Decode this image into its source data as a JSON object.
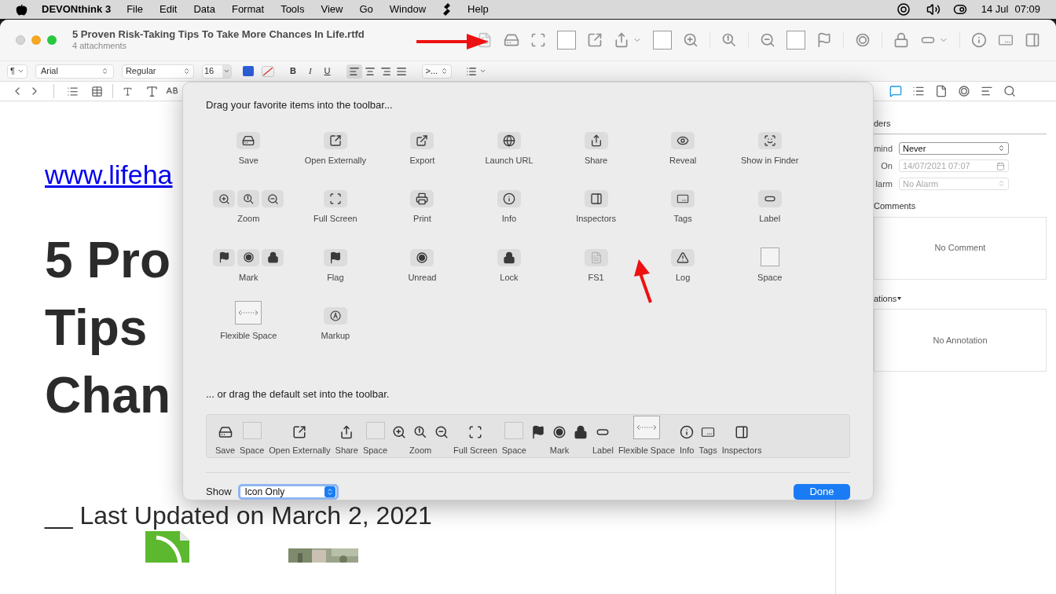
{
  "menubar": {
    "app": "DEVONthink 3",
    "menus": [
      "File",
      "Edit",
      "Data",
      "Format",
      "Tools",
      "View",
      "Go",
      "Window"
    ],
    "help": "Help",
    "date": "14 Jul",
    "time": "07:09"
  },
  "window": {
    "title": "5 Proven Risk-Taking Tips To Take More Chances In Life.rtfd",
    "subtitle": "4 attachments"
  },
  "toolbar": [
    {
      "kind": "fs1"
    },
    {
      "kind": "save"
    },
    {
      "kind": "fullscreen"
    },
    {
      "kind": "space"
    },
    {
      "kind": "openexternally"
    },
    {
      "kind": "share"
    },
    {
      "kind": "space"
    },
    {
      "kind": "zoomin"
    },
    {
      "kind": "actualsize"
    },
    {
      "kind": "zoomout"
    },
    {
      "kind": "space"
    },
    {
      "kind": "flag"
    },
    {
      "kind": "unread"
    },
    {
      "kind": "lock"
    },
    {
      "kind": "label"
    },
    {
      "kind": "info"
    },
    {
      "kind": "tags"
    },
    {
      "kind": "inspectors"
    }
  ],
  "format_bar": {
    "paragraph": "¶",
    "font": "Arial",
    "style": "Regular",
    "size": "16",
    "bold": "B",
    "italic": "I",
    "underline": "U",
    "alignment": [
      {
        "kind": "left",
        "selected": true
      },
      {
        "kind": "center",
        "selected": false
      },
      {
        "kind": "right",
        "selected": false
      },
      {
        "kind": "justify",
        "selected": false
      }
    ],
    "spacing": ">..."
  },
  "inspector_tabs": [
    {
      "kind": "comment",
      "selected": true
    },
    {
      "kind": "list",
      "selected": false
    },
    {
      "kind": "document",
      "selected": false
    },
    {
      "kind": "circle",
      "selected": false
    },
    {
      "kind": "lines",
      "selected": false
    },
    {
      "kind": "search",
      "selected": false
    }
  ],
  "document": {
    "link": "www.lifeha",
    "heading": [
      "5 Pro",
      "Tips",
      "Chan"
    ],
    "updated": "__ Last Updated on March 2, 2021"
  },
  "inspector": {
    "reminders": "ders",
    "fields": [
      {
        "label": "mind",
        "value": "Never",
        "disabled": false,
        "kind": "popup"
      },
      {
        "label": "On",
        "value": "14/07/2021 07:07",
        "disabled": true,
        "kind": "date"
      },
      {
        "label": "larm",
        "value": "No Alarm",
        "disabled": true,
        "kind": "popup"
      }
    ],
    "comments": {
      "heading": "Comments",
      "text": "No Comment"
    },
    "annotations": {
      "heading": "ations",
      "text": "No Annotation"
    }
  },
  "sheet": {
    "intro": "Drag your favorite items into the toolbar...",
    "items": [
      {
        "kind": "save",
        "label": "Save"
      },
      {
        "kind": "openexternally",
        "label": "Open Externally"
      },
      {
        "kind": "export",
        "label": "Export"
      },
      {
        "kind": "launchurl",
        "label": "Launch URL"
      },
      {
        "kind": "share",
        "label": "Share"
      },
      {
        "kind": "reveal",
        "label": "Reveal"
      },
      {
        "kind": "finder",
        "label": "Show in Finder"
      },
      {
        "kind": "zoom",
        "label": "Zoom"
      },
      {
        "kind": "fullscreen",
        "label": "Full Screen"
      },
      {
        "kind": "print",
        "label": "Print"
      },
      {
        "kind": "info",
        "label": "Info"
      },
      {
        "kind": "inspectors",
        "label": "Inspectors"
      },
      {
        "kind": "tags",
        "label": "Tags"
      },
      {
        "kind": "label",
        "label": "Label"
      },
      {
        "kind": "mark",
        "label": "Mark"
      },
      {
        "kind": "flag",
        "label": "Flag"
      },
      {
        "kind": "unread",
        "label": "Unread"
      },
      {
        "kind": "lock",
        "label": "Lock"
      },
      {
        "kind": "fs1",
        "label": "FS1"
      },
      {
        "kind": "log",
        "label": "Log"
      },
      {
        "kind": "space",
        "label": "Space"
      },
      {
        "kind": "flexiblespace",
        "label": "Flexible Space"
      },
      {
        "kind": "markup",
        "label": "Markup"
      }
    ],
    "default_intro": "... or drag the default set into the toolbar.",
    "default_set": [
      {
        "kind": "save",
        "label": "Save"
      },
      {
        "kind": "space",
        "label": "Space"
      },
      {
        "kind": "openexternally",
        "label": "Open Externally"
      },
      {
        "kind": "share",
        "label": "Share"
      },
      {
        "kind": "space",
        "label": "Space"
      },
      {
        "kind": "zoom",
        "label": "Zoom"
      },
      {
        "kind": "fullscreen",
        "label": "Full Screen"
      },
      {
        "kind": "space",
        "label": "Space"
      },
      {
        "kind": "mark",
        "label": "Mark"
      },
      {
        "kind": "label",
        "label": "Label"
      },
      {
        "kind": "flexiblespace",
        "label": "Flexible Space"
      },
      {
        "kind": "info",
        "label": "Info"
      },
      {
        "kind": "tags",
        "label": "Tags"
      },
      {
        "kind": "inspectors",
        "label": "Inspectors"
      }
    ],
    "show_label": "Show",
    "show_value": "Icon Only",
    "done": "Done"
  }
}
